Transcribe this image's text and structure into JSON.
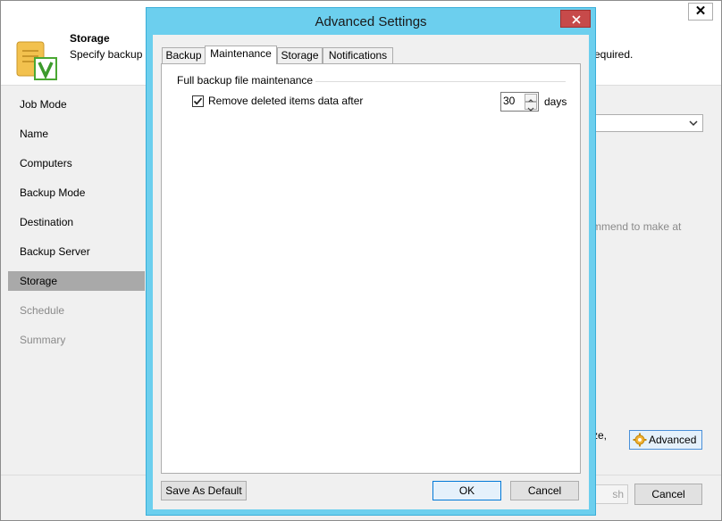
{
  "wizard": {
    "step_title": "Storage",
    "step_description": "Specify backup",
    "step_description_tail": "required.",
    "nav": [
      {
        "label": "Job Mode",
        "state": "normal"
      },
      {
        "label": "Name",
        "state": "normal"
      },
      {
        "label": "Computers",
        "state": "normal"
      },
      {
        "label": "Backup Mode",
        "state": "normal"
      },
      {
        "label": "Destination",
        "state": "normal"
      },
      {
        "label": "Backup Server",
        "state": "normal"
      },
      {
        "label": "Storage",
        "state": "active"
      },
      {
        "label": "Schedule",
        "state": "disabled"
      },
      {
        "label": "Summary",
        "state": "disabled"
      }
    ],
    "hint_fragment": "mmend to make at",
    "size_fragment": "ze,",
    "advanced_label": "Advanced",
    "finish_fragment": "sh",
    "cancel_label": "Cancel",
    "close_glyph": "✕"
  },
  "dialog": {
    "title": "Advanced Settings",
    "tabs": [
      "Backup",
      "Maintenance",
      "Storage",
      "Notifications"
    ],
    "selected_tab": "Maintenance",
    "group_label": "Full backup file maintenance",
    "remove_deleted": {
      "checked": true,
      "label": "Remove deleted items data after",
      "value": "30",
      "unit": "days"
    },
    "save_default_label": "Save As Default",
    "ok_label": "OK",
    "cancel_label": "Cancel"
  },
  "colors": {
    "dialog_frame": "#6ccfee",
    "close_button": "#c74a4a",
    "active_nav": "#a9a9a9"
  }
}
